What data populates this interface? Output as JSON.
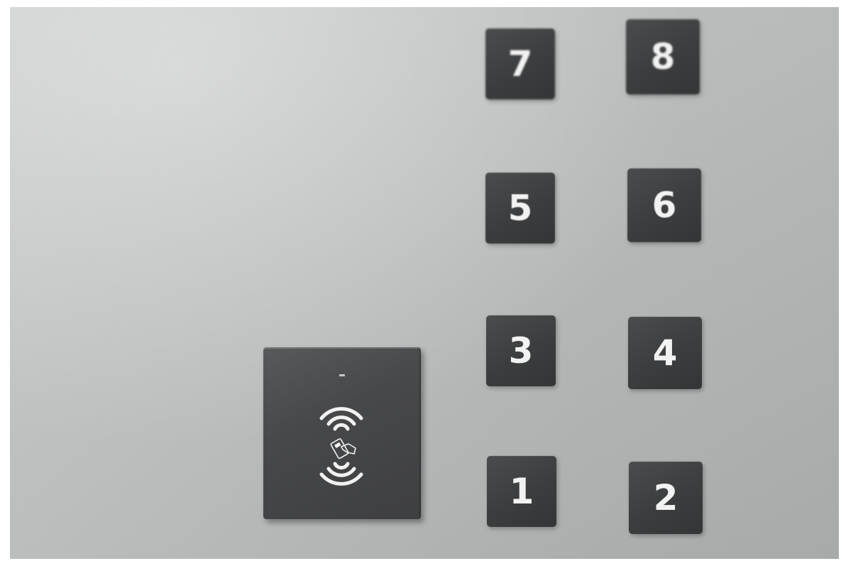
{
  "scene": {
    "description_label": "elevator-panel",
    "wall_color": "#b9bcbb",
    "button_color": "#3e4041",
    "label_color": "#f2f2f2"
  },
  "floor_buttons": [
    {
      "label": "7"
    },
    {
      "label": "8"
    },
    {
      "label": "5"
    },
    {
      "label": "6"
    },
    {
      "label": "3"
    },
    {
      "label": "4"
    },
    {
      "label": "1"
    },
    {
      "label": "2"
    }
  ],
  "card_reader": {
    "icon": "nfc-contactless-icon",
    "indicator": "status-led"
  }
}
